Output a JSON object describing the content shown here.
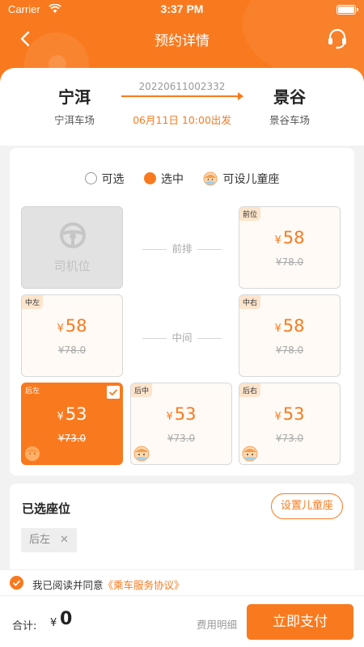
{
  "status_bar": {
    "carrier": "Carrier",
    "time": "3:37 PM"
  },
  "nav": {
    "title": "预约详情",
    "back_icon": "chevron-left-icon",
    "service_icon": "headset-icon"
  },
  "trip": {
    "order_no": "20220611002332",
    "from_city": "宁洱",
    "from_station": "宁洱车场",
    "to_city": "景谷",
    "to_station": "景谷车场",
    "depart": "06月11日 10:00出发"
  },
  "legend": {
    "available": "可选",
    "selected": "选中",
    "child_seat": "可设儿童座"
  },
  "seat_map": {
    "driver_label": "司机位",
    "row_front": "前排",
    "row_middle": "中间",
    "currency": "¥",
    "seats": [
      {
        "tag": "前位",
        "price": "58",
        "original": "¥78.0",
        "selected": false,
        "child": false
      },
      {
        "tag": "中左",
        "price": "58",
        "original": "¥78.0",
        "selected": false,
        "child": false
      },
      {
        "tag": "中右",
        "price": "58",
        "original": "¥78.0",
        "selected": false,
        "child": false
      },
      {
        "tag": "后左",
        "price": "53",
        "original": "¥73.0",
        "selected": true,
        "child": true
      },
      {
        "tag": "后中",
        "price": "53",
        "original": "¥73.0",
        "selected": false,
        "child": true
      },
      {
        "tag": "后右",
        "price": "53",
        "original": "¥73.0",
        "selected": false,
        "child": true
      }
    ]
  },
  "selected_seats": {
    "title": "已选座位",
    "child_button": "设置儿童座",
    "chips": [
      {
        "label": "后左",
        "remove": "✕"
      }
    ]
  },
  "agreement": {
    "text": "我已阅读并同意",
    "link": "《乘车服务协议》",
    "checked": true
  },
  "footer": {
    "total_label": "合计:",
    "currency": "¥",
    "amount": "0",
    "detail": "费用明细",
    "pay": "立即支付"
  },
  "colors": {
    "accent": "#f97a1e"
  }
}
